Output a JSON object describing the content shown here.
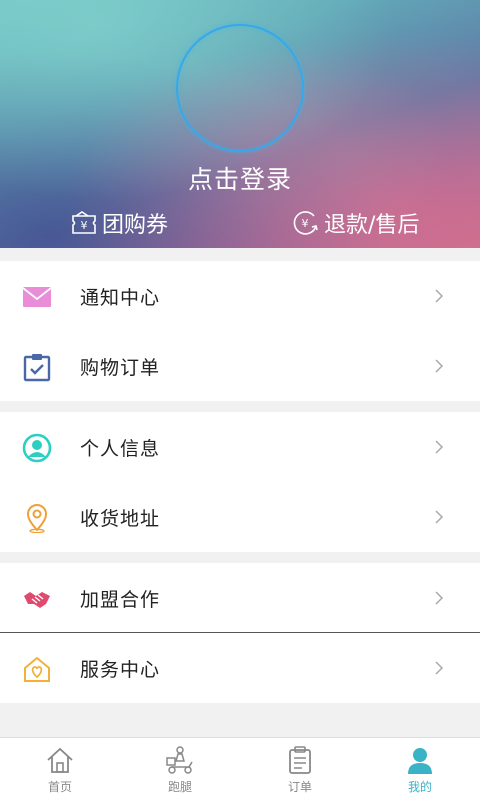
{
  "header": {
    "login_text": "点击登录",
    "coupon_label": "团购券",
    "refund_label": "退款/售后"
  },
  "menu": {
    "group1": [
      {
        "label": "通知中心",
        "icon": "envelope-icon",
        "color": "#e57fcf"
      },
      {
        "label": "购物订单",
        "icon": "clipboard-check-icon",
        "color": "#4a67a8"
      }
    ],
    "group2": [
      {
        "label": "个人信息",
        "icon": "user-circle-icon",
        "color": "#2ccfc0"
      },
      {
        "label": "收货地址",
        "icon": "location-pin-icon",
        "color": "#f0a03a"
      }
    ],
    "group3": [
      {
        "label": "加盟合作",
        "icon": "handshake-icon",
        "color": "#e04a6e"
      },
      {
        "label": "服务中心",
        "icon": "heart-house-icon",
        "color": "#f2b23a"
      }
    ]
  },
  "tabbar": {
    "tabs": [
      {
        "label": "首页",
        "icon": "home-icon"
      },
      {
        "label": "跑腿",
        "icon": "delivery-scooter-icon"
      },
      {
        "label": "订单",
        "icon": "order-clipboard-icon"
      },
      {
        "label": "我的",
        "icon": "person-icon",
        "active": true
      }
    ],
    "active_color": "#3ab3c6",
    "inactive_color": "#888888"
  }
}
